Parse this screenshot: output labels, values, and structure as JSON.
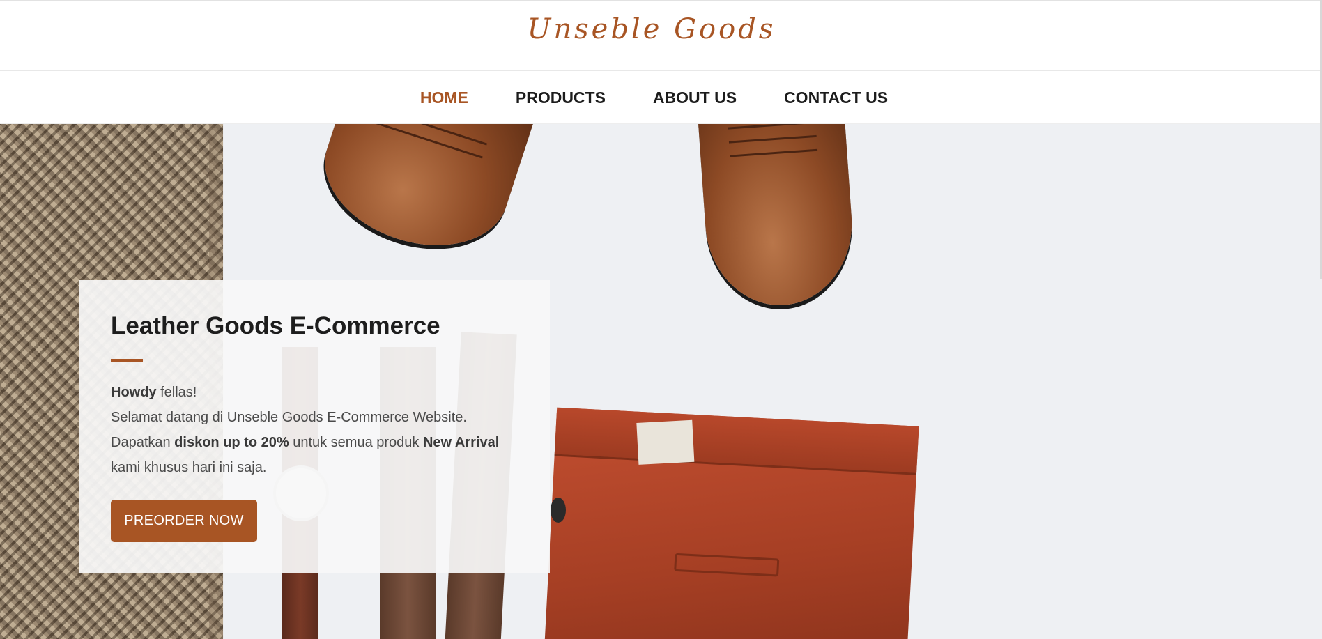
{
  "brand": {
    "logo_text": "Unseble Goods",
    "accent_color": "#a85524"
  },
  "nav": {
    "items": [
      {
        "label": "HOME",
        "active": true
      },
      {
        "label": "PRODUCTS",
        "active": false
      },
      {
        "label": "ABOUT US",
        "active": false
      },
      {
        "label": "CONTACT US",
        "active": false
      }
    ]
  },
  "hero": {
    "title": "Leather Goods E-Commerce",
    "greeting_bold": "Howdy",
    "greeting_rest": " fellas!",
    "line2": "Selamat datang di Unseble Goods E-Commerce Website.",
    "line3_pre": "Dapatkan ",
    "line3_bold": "diskon up to 20%",
    "line3_mid": " untuk semua produk ",
    "line3_bold2": "New Arrival",
    "line4": "kami khusus hari ini saja.",
    "cta_label": "PREORDER NOW",
    "image_subject": "leather shoes, belt, watch and red trousers flat-lay"
  }
}
